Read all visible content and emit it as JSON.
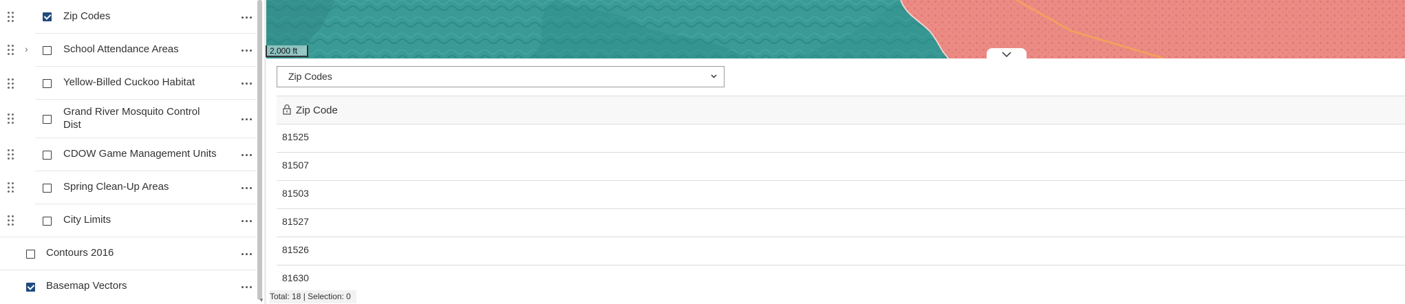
{
  "layers": {
    "sub_items": [
      {
        "label": "Zip Codes",
        "checked": true,
        "expandable": false
      },
      {
        "label": "School Attendance Areas",
        "checked": false,
        "expandable": true
      },
      {
        "label": "Yellow-Billed Cuckoo Habitat",
        "checked": false,
        "expandable": false
      },
      {
        "label": "Grand River Mosquito Control",
        "label_line2": "Dist",
        "checked": false,
        "expandable": false
      },
      {
        "label": "CDOW Game Management Units",
        "checked": false,
        "expandable": false
      },
      {
        "label": "Spring Clean-Up Areas",
        "checked": false,
        "expandable": false
      },
      {
        "label": "City Limits",
        "checked": false,
        "expandable": false
      }
    ],
    "top_items": [
      {
        "label": "Contours 2016",
        "checked": false
      },
      {
        "label": "Basemap Vectors",
        "checked": true
      }
    ]
  },
  "map": {
    "scale_label": "2,000 ft",
    "colors": {
      "terrain": "#3a9a95",
      "city": "#ec8a84",
      "road": "#f2a060"
    }
  },
  "table": {
    "selected_layer": "Zip Codes",
    "column_header": "Zip Code",
    "rows": [
      "81525",
      "81507",
      "81503",
      "81527",
      "81526",
      "81630"
    ],
    "footer": "Total: 18 | Selection: 0"
  }
}
